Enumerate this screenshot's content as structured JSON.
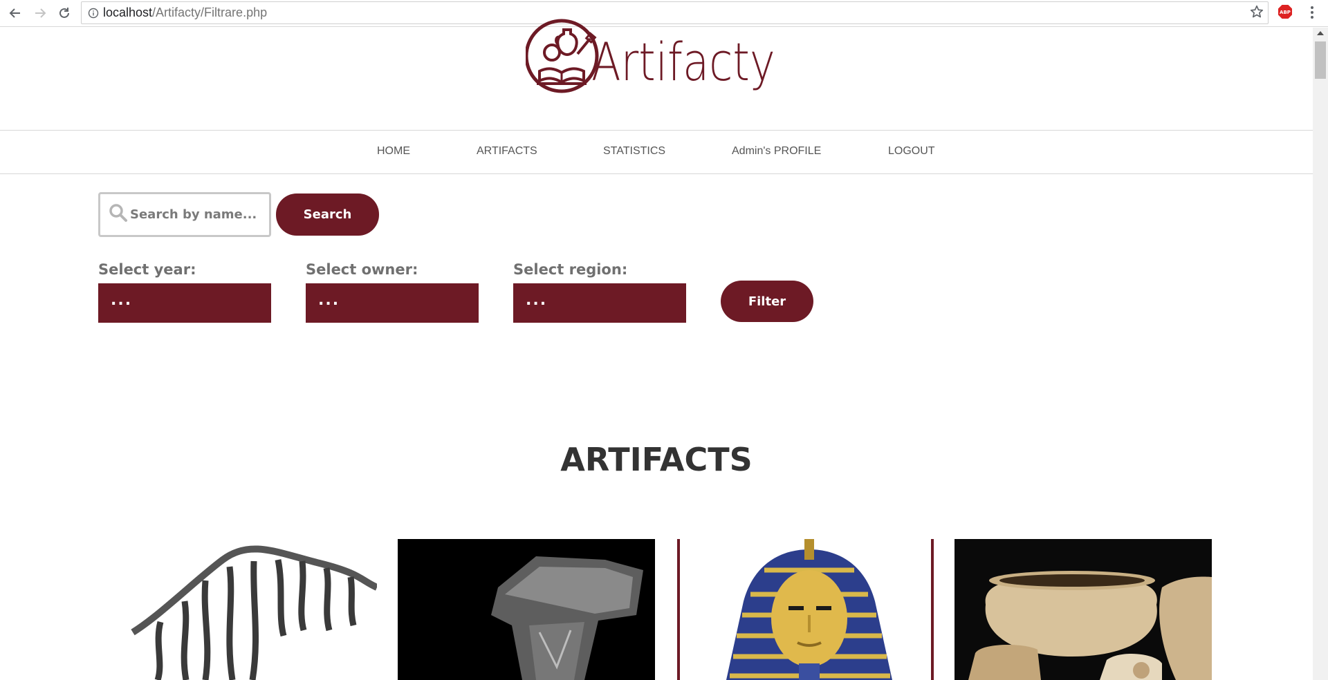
{
  "browser": {
    "url_host": "localhost",
    "url_path": "/Artifacty/Filtrare.php",
    "extension_label": "ABP"
  },
  "site": {
    "logo_text": "Artifacty",
    "brand_color": "#6d1a25"
  },
  "menu": [
    {
      "label": "HOME"
    },
    {
      "label": "ARTIFACTS"
    },
    {
      "label": "STATISTICS"
    },
    {
      "label": "Admin's PROFILE"
    },
    {
      "label": "LOGOUT"
    }
  ],
  "search": {
    "placeholder": "Search by name...",
    "button_label": "Search"
  },
  "filters": {
    "year": {
      "label": "Select year:",
      "value": "..."
    },
    "owner": {
      "label": "Select owner:",
      "value": "..."
    },
    "region": {
      "label": "Select region:",
      "value": "..."
    },
    "button_label": "Filter"
  },
  "artifacts": {
    "title": "ARTIFACTS"
  }
}
